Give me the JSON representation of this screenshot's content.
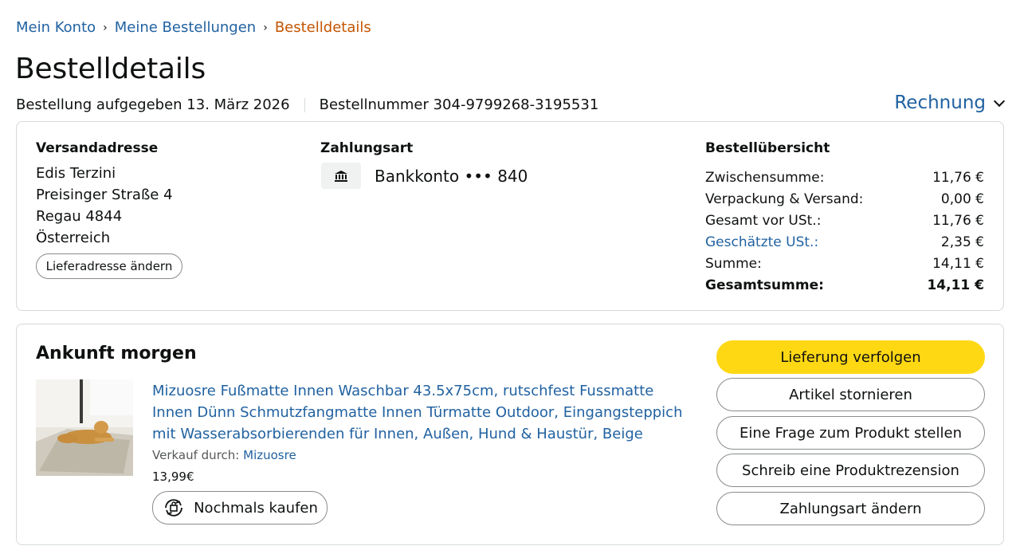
{
  "breadcrumb": {
    "items": [
      "Mein Konto",
      "Meine Bestellungen"
    ],
    "current": "Bestelldetails",
    "separator": "›"
  },
  "page": {
    "title": "Bestelldetails",
    "order_placed": "Bestellung aufgegeben 13. März 2026",
    "order_number": "Bestellnummer 304-9799268-3195531",
    "invoice_label": "Rechnung"
  },
  "shipping": {
    "title": "Versandadresse",
    "lines": [
      "Edis Terzini",
      "Preisinger Straße 4",
      "Regau 4844",
      "Österreich"
    ],
    "change_button": "Lieferadresse ändern"
  },
  "payment": {
    "title": "Zahlungsart",
    "icon": "bank-icon",
    "method": "Bankkonto ••• 840"
  },
  "summary": {
    "title": "Bestellübersicht",
    "rows": [
      {
        "label": "Zwischensumme:",
        "value": "11,76 €"
      },
      {
        "label": "Verpackung & Versand:",
        "value": "0,00 €"
      },
      {
        "label": "Gesamt vor USt.:",
        "value": "11,76 €"
      },
      {
        "label": "Geschätzte USt.:",
        "value": "2,35 €"
      },
      {
        "label": "Summe:",
        "value": "14,11 €"
      },
      {
        "label": "Gesamtsumme:",
        "value": "14,11 €"
      }
    ]
  },
  "shipment": {
    "status": "Ankunft morgen",
    "product": {
      "title": "Mizuosre Fußmatte Innen Waschbar 43.5x75cm, rutschfest Fussmatte Innen Dünn Schmutzfangmatte Innen Türmatte Outdoor, Eingangsteppich mit Wasserabsorbierenden für Innen, Außen, Hund & Haustür, Beige",
      "seller_label": "Verkauf durch:",
      "seller": "Mizuosre",
      "price": "13,99€",
      "buy_again": "Nochmals kaufen"
    },
    "actions": [
      "Lieferung verfolgen",
      "Artikel stornieren",
      "Eine Frage zum Produkt stellen",
      "Schreib eine Produktrezension",
      "Zahlungsart ändern"
    ]
  },
  "colors": {
    "link": "#2162a1",
    "breadcrumb_current": "#c45500",
    "primary_button": "#ffd814",
    "border": "#d5d9d9"
  }
}
